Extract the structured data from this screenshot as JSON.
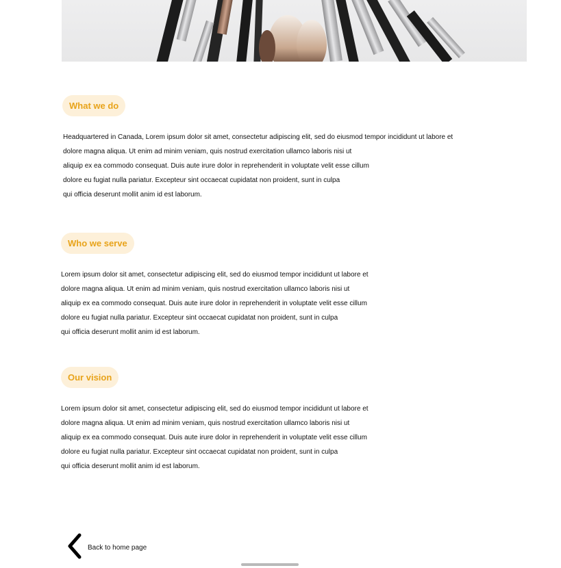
{
  "hero": {
    "alt_subject": "brush-image"
  },
  "sections": [
    {
      "heading": "What we do",
      "lines": [
        "Headquartered in Canada,  Lorem ipsum dolor sit amet, consectetur adipiscing elit, sed do eiusmod tempor incididunt ut labore et",
        "dolore magna aliqua. Ut enim ad minim veniam, quis nostrud exercitation ullamco laboris nisi ut",
        "aliquip ex ea commodo consequat. Duis aute irure dolor in reprehenderit in voluptate velit esse cillum",
        "dolore eu fugiat nulla pariatur. Excepteur sint occaecat cupidatat non proident, sunt in culpa",
        "qui officia deserunt mollit anim id est laborum."
      ]
    },
    {
      "heading": "Who we serve",
      "lines": [
        "Lorem ipsum dolor sit amet, consectetur adipiscing elit, sed do eiusmod tempor incididunt ut labore et",
        "dolore magna aliqua. Ut enim ad minim veniam, quis nostrud exercitation ullamco laboris nisi ut",
        "aliquip ex ea commodo consequat. Duis aute irure dolor in reprehenderit in voluptate velit esse cillum",
        "dolore eu fugiat nulla pariatur. Excepteur sint occaecat cupidatat non proident, sunt in culpa",
        "qui officia deserunt mollit anim id est laborum."
      ]
    },
    {
      "heading": "Our vision",
      "lines": [
        "Lorem ipsum dolor sit amet, consectetur adipiscing elit, sed do eiusmod tempor incididunt ut labore et",
        "dolore magna aliqua. Ut enim ad minim veniam, quis nostrud exercitation ullamco laboris nisi ut",
        "aliquip ex ea commodo consequat. Duis aute irure dolor in reprehenderit in voluptate velit esse cillum",
        "dolore eu fugiat nulla pariatur. Excepteur sint occaecat cupidatat non proident, sunt in culpa",
        "qui officia deserunt mollit anim id est laborum."
      ]
    }
  ],
  "back": {
    "label": "Back to home page",
    "icon": "chevron-left-icon"
  },
  "colors": {
    "accent": "#e8a31a",
    "pill_bg": "#fdf0d9",
    "text": "#111111"
  }
}
